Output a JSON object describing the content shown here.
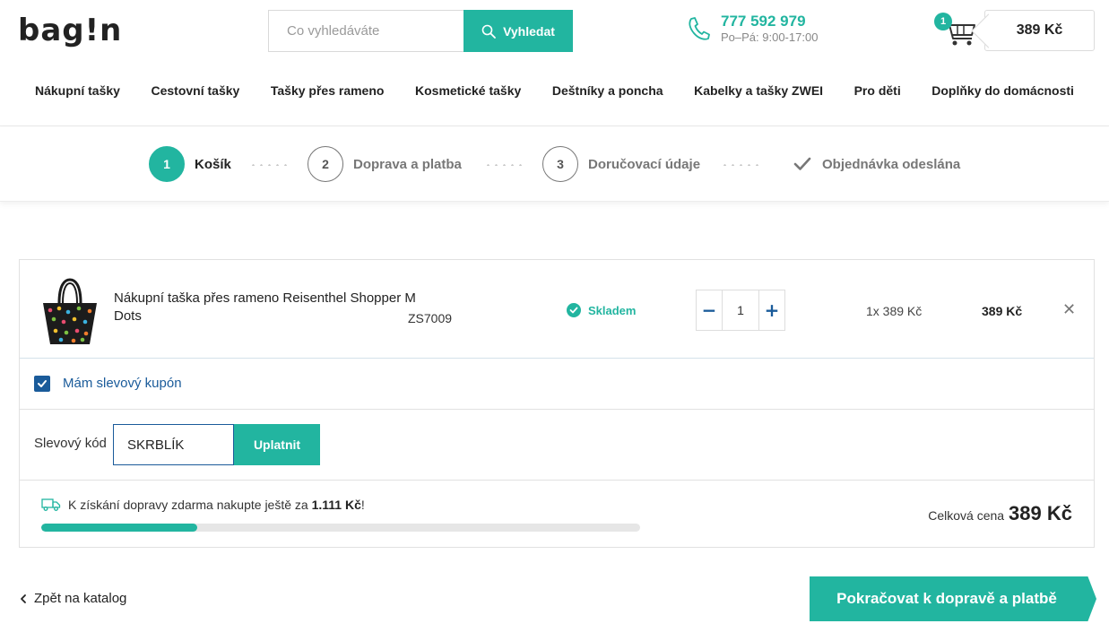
{
  "header": {
    "logo": "bag!n",
    "search_placeholder": "Co vyhledáváte",
    "search_button": "Vyhledat",
    "phone": "777 592 979",
    "hours": "Po–Pá: 9:00-17:00",
    "cart_count": "1",
    "cart_total": "389 Kč"
  },
  "nav": {
    "items": [
      "Nákupní tašky",
      "Cestovní tašky",
      "Tašky přes rameno",
      "Kosmetické tašky",
      "Deštníky a poncha",
      "Kabelky a tašky ZWEI",
      "Pro děti",
      "Doplňky do domácnosti"
    ]
  },
  "steps": [
    {
      "number": "1",
      "label": "Košík",
      "active": true
    },
    {
      "number": "2",
      "label": "Doprava a platba",
      "active": false
    },
    {
      "number": "3",
      "label": "Doručovací údaje",
      "active": false
    },
    {
      "icon": "check-icon",
      "label": "Objednávka odeslána",
      "active": false
    }
  ],
  "cart": {
    "item": {
      "name": "Nákupní taška přes rameno Reisenthel Shopper M Dots",
      "code": "ZS7009",
      "stock": "Skladem",
      "quantity": "1",
      "unit_price": "1x 389 Kč",
      "total": "389 Kč"
    },
    "coupon_label": "Mám slevový kupón",
    "coupon_checked": true,
    "code_label": "Slevový kód",
    "code_value": "SKRBLÍK",
    "apply_button": "Uplatnit",
    "shipping_prefix": "K získání dopravy zdarma nakupte ještě za ",
    "shipping_amount": "1.111 Kč",
    "shipping_suffix": "!",
    "shipping_progress": 0.26,
    "total_label": "Celková cena",
    "total_value": "389 Kč"
  },
  "footer": {
    "back_label": "Zpět na katalog",
    "continue_label": "Pokračovat k dopravě a platbě"
  },
  "colors": {
    "accent": "#22b5a0",
    "link": "#1a5b9a"
  }
}
